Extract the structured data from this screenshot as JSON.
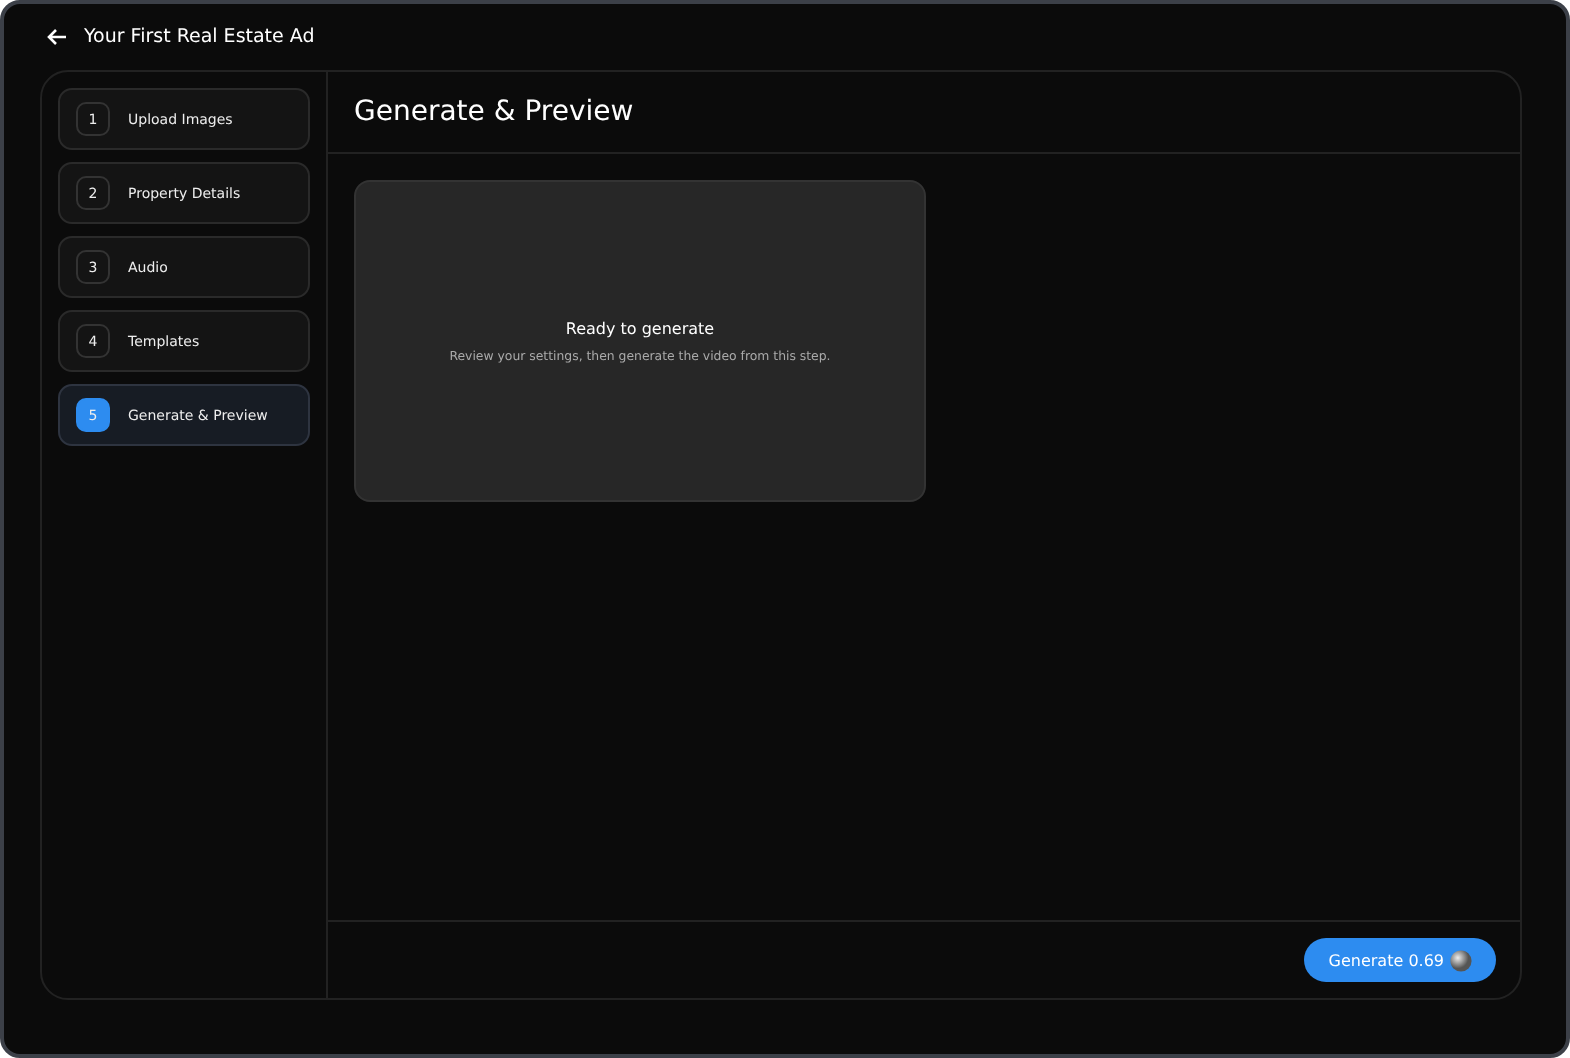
{
  "window": {
    "title": "Your First Real Estate Ad"
  },
  "steps": [
    {
      "number": "1",
      "label": "Upload Images",
      "selected": false
    },
    {
      "number": "2",
      "label": "Property Details",
      "selected": false
    },
    {
      "number": "3",
      "label": "Audio",
      "selected": false
    },
    {
      "number": "4",
      "label": "Templates",
      "selected": false
    },
    {
      "number": "5",
      "label": "Generate & Preview",
      "selected": true
    }
  ],
  "main": {
    "title": "Generate & Preview",
    "preview": {
      "heading": "Ready to generate",
      "message": "Review your settings, then generate the video from this step."
    }
  },
  "footer": {
    "button": {
      "label": "Generate",
      "cost": "0.69"
    }
  }
}
